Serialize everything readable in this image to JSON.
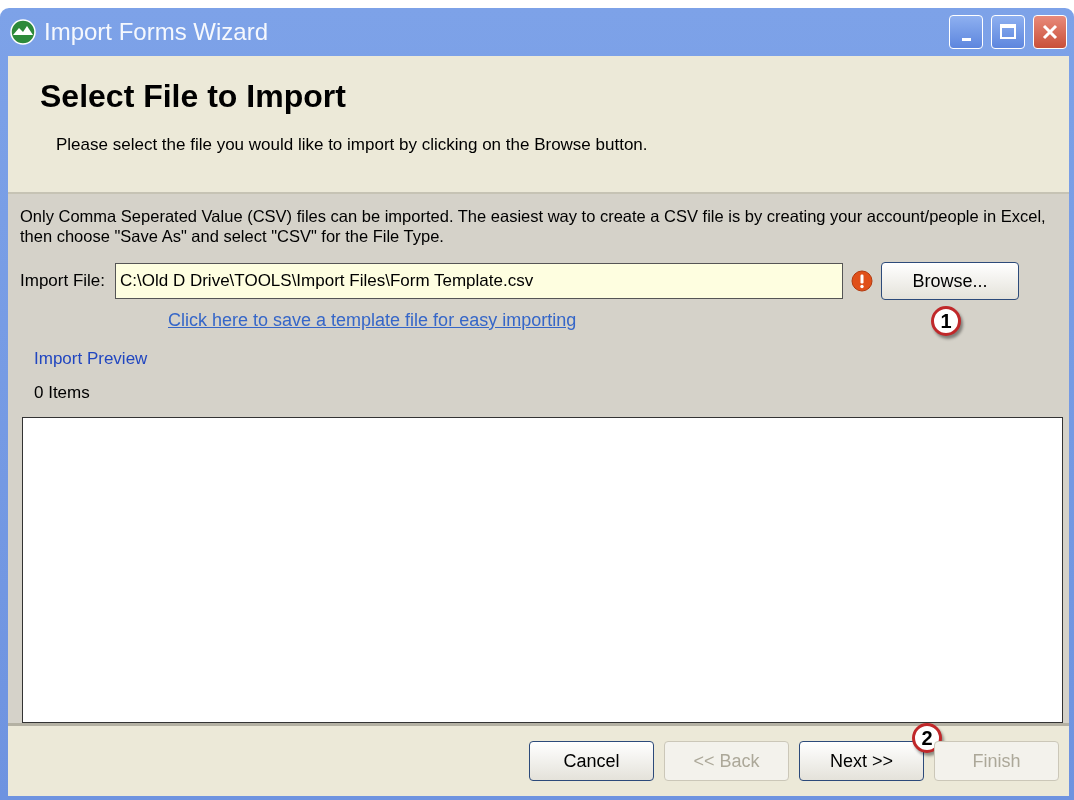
{
  "window": {
    "title": "Import Forms Wizard"
  },
  "header": {
    "title": "Select File to Import",
    "subtitle": "Please select the file you would like to import by clicking on the Browse button."
  },
  "info": "Only Comma Seperated Value (CSV) files can be imported. The easiest way to create a CSV file is by creating your account/people in Excel, then choose \"Save As\" and select \"CSV\" for the File Type.",
  "import_file": {
    "label": "Import File:",
    "value": "C:\\Old D Drive\\TOOLS\\Import Files\\Form Template.csv",
    "warning": true
  },
  "browse_button": {
    "label": "Browse...",
    "callout": "1"
  },
  "template_link": "Click here to save a template file for easy importing",
  "preview": {
    "label": "Import Preview",
    "count": "0 Items"
  },
  "buttons": [
    {
      "label": "Cancel",
      "disabled": false
    },
    {
      "label": "<< Back",
      "disabled": true
    },
    {
      "label": "Next >>",
      "disabled": false,
      "callout": "2"
    },
    {
      "label": "Finish",
      "disabled": true
    }
  ]
}
